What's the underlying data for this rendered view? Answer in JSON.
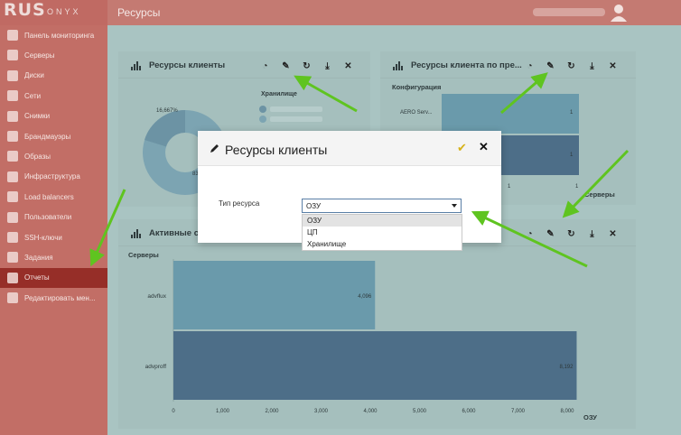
{
  "brand": {
    "logo_main": "RUS",
    "logo_rest": "ONYX"
  },
  "header": {
    "title": "Ресурсы"
  },
  "sidebar": {
    "items": [
      {
        "label": "Панель мониторинга",
        "icon": "dashboard-icon"
      },
      {
        "label": "Серверы",
        "icon": "server-icon"
      },
      {
        "label": "Диски",
        "icon": "disk-icon"
      },
      {
        "label": "Сети",
        "icon": "network-icon"
      },
      {
        "label": "Снимки",
        "icon": "camera-icon"
      },
      {
        "label": "Брандмауэры",
        "icon": "fire-icon"
      },
      {
        "label": "Образы",
        "icon": "image-icon"
      },
      {
        "label": "Инфраструктура",
        "icon": "infrastructure-icon"
      },
      {
        "label": "Load balancers",
        "icon": "shuffle-icon"
      },
      {
        "label": "Пользователи",
        "icon": "user-icon"
      },
      {
        "label": "SSH-ключи",
        "icon": "key-icon"
      },
      {
        "label": "Задания",
        "icon": "tasks-icon"
      },
      {
        "label": "Отчеты",
        "icon": "reports-icon",
        "active": true
      },
      {
        "label": "Редактировать мен...",
        "icon": "pencil-icon"
      }
    ]
  },
  "panel1": {
    "title": "Ресурсы клиенты",
    "legend_title": "Хранилище",
    "pie_label_1": "16,667%",
    "pie_label_2": "83,"
  },
  "panel2": {
    "title": "Ресурсы клиента по пре...",
    "section": "Конфигурация",
    "row1": "AERO Serv...",
    "row1_value": "1",
    "row2_value": "1",
    "axis_label": "1",
    "axis_label2": "1",
    "axis_title": "Серверы"
  },
  "panel3": {
    "title": "Активные се...",
    "section": "Серверы",
    "axis_title": "ОЗУ"
  },
  "dialog": {
    "title": "Ресурсы клиенты",
    "field_label": "Тип ресурса",
    "selected": "ОЗУ",
    "options": [
      "ОЗУ",
      "ЦП",
      "Хранилище"
    ]
  },
  "chart_data": {
    "type": "bar",
    "orientation": "horizontal",
    "categories": [
      "advflux",
      "advproff"
    ],
    "values": [
      4096,
      8192
    ],
    "value_labels": [
      "4,096",
      "8,192"
    ],
    "xlim": [
      0,
      8000
    ],
    "xticks": [
      "0",
      "1,000",
      "2,000",
      "3,000",
      "4,000",
      "5,000",
      "6,000",
      "7,000",
      "8,000"
    ],
    "ylabel": "Серверы",
    "xlabel": "ОЗУ",
    "colors": [
      "#6a9aab",
      "#4d6e88"
    ]
  }
}
